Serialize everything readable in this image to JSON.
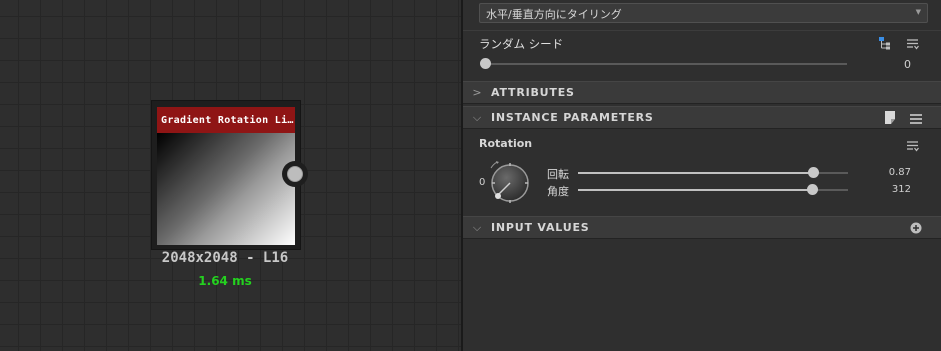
{
  "graph": {
    "node": {
      "title": "Gradient Rotation Li…",
      "resolution": "2048x2048 - L16",
      "time": "1.64 ms"
    }
  },
  "panel": {
    "tiling": {
      "value": "水平/垂直方向にタイリング"
    },
    "random_seed": {
      "label": "ランダム シード",
      "value": "0",
      "fraction": 0.0
    },
    "sections": {
      "attributes": "ATTRIBUTES",
      "instance_parameters": "INSTANCE PARAMETERS",
      "input_values": "INPUT VALUES"
    },
    "rotation": {
      "group_label": "Rotation",
      "dial_value": "0",
      "turns": {
        "label": "回転",
        "value": "0.87",
        "fraction": 0.87
      },
      "angle": {
        "label": "角度",
        "value": "312",
        "fraction": 0.866
      }
    }
  },
  "colors": {
    "node_header": "#8f1515",
    "time_text": "#24d11f",
    "accent_blue": "#3a8ee6"
  },
  "icons": [
    "chevron-down-icon",
    "hierarchy-icon",
    "menu-icon",
    "chevron-right-icon",
    "page-icon",
    "plus-circle-icon"
  ]
}
